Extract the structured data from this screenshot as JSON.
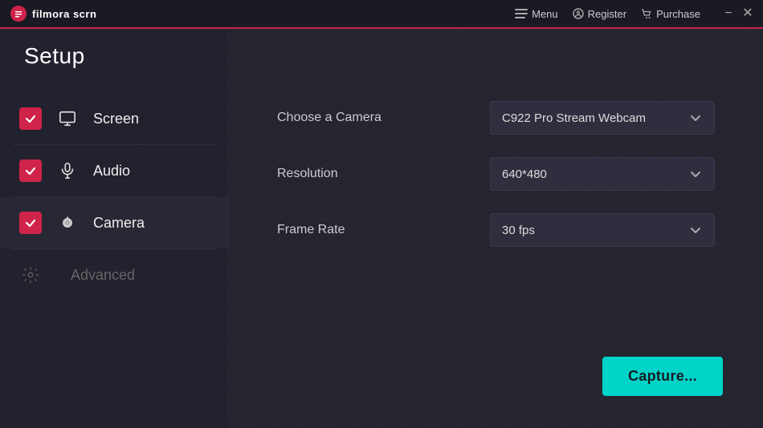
{
  "titlebar": {
    "logo_text": "filmora scrn",
    "menu_label": "Menu",
    "register_label": "Register",
    "purchase_label": "Purchase"
  },
  "page": {
    "title": "Setup"
  },
  "sidebar": {
    "items": [
      {
        "id": "screen",
        "label": "Screen",
        "checked": true
      },
      {
        "id": "audio",
        "label": "Audio",
        "checked": true
      },
      {
        "id": "camera",
        "label": "Camera",
        "checked": true
      },
      {
        "id": "advanced",
        "label": "Advanced",
        "checked": false
      }
    ]
  },
  "settings": {
    "camera_label": "Choose a Camera",
    "camera_value": "C922 Pro Stream Webcam",
    "resolution_label": "Resolution",
    "resolution_value": "640*480",
    "framerate_label": "Frame Rate",
    "framerate_value": "30 fps"
  },
  "capture_button": "Capture..."
}
